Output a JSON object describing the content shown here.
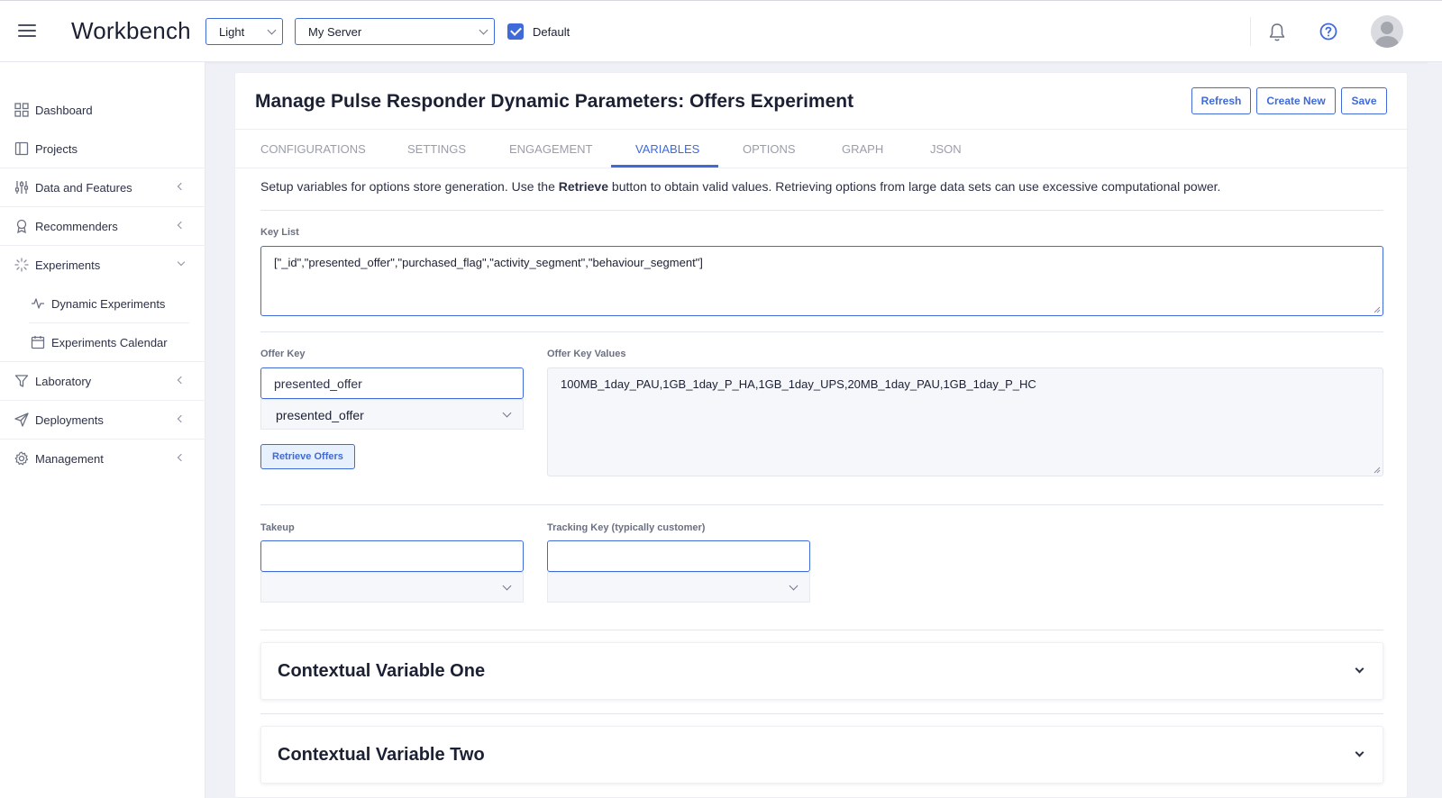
{
  "topbar": {
    "brand": "Workbench",
    "theme_select": "Light",
    "server_select": "My Server",
    "default_checked": true,
    "default_label": "Default"
  },
  "sidebar": {
    "items": [
      {
        "label": "Dashboard",
        "icon": "grid-icon"
      },
      {
        "label": "Projects",
        "icon": "book-icon"
      },
      {
        "label": "Data and Features",
        "icon": "sliders-icon"
      },
      {
        "label": "Recommenders",
        "icon": "award-icon"
      },
      {
        "label": "Experiments",
        "icon": "loader-icon"
      },
      {
        "label": "Laboratory",
        "icon": "filter-icon"
      },
      {
        "label": "Deployments",
        "icon": "send-icon"
      },
      {
        "label": "Management",
        "icon": "gear-icon"
      }
    ],
    "sub_items": [
      {
        "label": "Dynamic Experiments",
        "icon": "activity-icon"
      },
      {
        "label": "Experiments Calendar",
        "icon": "calendar-icon"
      }
    ]
  },
  "main": {
    "title": "Manage Pulse Responder Dynamic Parameters: Offers Experiment",
    "buttons": {
      "refresh": "Refresh",
      "create_new": "Create New",
      "save": "Save"
    },
    "tabs": [
      {
        "label": "CONFIGURATIONS"
      },
      {
        "label": "SETTINGS"
      },
      {
        "label": "ENGAGEMENT"
      },
      {
        "label": "VARIABLES",
        "active": true
      },
      {
        "label": "OPTIONS"
      },
      {
        "label": "GRAPH"
      },
      {
        "label": "JSON"
      }
    ],
    "intro_before": "Setup variables for options store generation. Use the ",
    "intro_bold": "Retrieve",
    "intro_after": " button to obtain valid values. Retrieving options from large data sets can use excessive computational power.",
    "key_list": {
      "label": "Key List",
      "value": "[\"_id\",\"presented_offer\",\"purchased_flag\",\"activity_segment\",\"behaviour_segment\"]"
    },
    "offer_key": {
      "label": "Offer Key",
      "input_value": "presented_offer",
      "select_value": "presented_offer",
      "retrieve_button": "Retrieve Offers"
    },
    "offer_key_values": {
      "label": "Offer Key Values",
      "value": "100MB_1day_PAU,1GB_1day_P_HA,1GB_1day_UPS,20MB_1day_PAU,1GB_1day_P_HC"
    },
    "takeup": {
      "label": "Takeup",
      "input_value": "",
      "select_value": ""
    },
    "tracking_key": {
      "label": "Tracking Key (typically customer)",
      "input_value": "",
      "select_value": ""
    },
    "accordions": [
      {
        "title": "Contextual Variable One"
      },
      {
        "title": "Contextual Variable Two"
      }
    ]
  },
  "colors": {
    "accent": "#3f6ad8",
    "background": "#f0f1f7"
  }
}
